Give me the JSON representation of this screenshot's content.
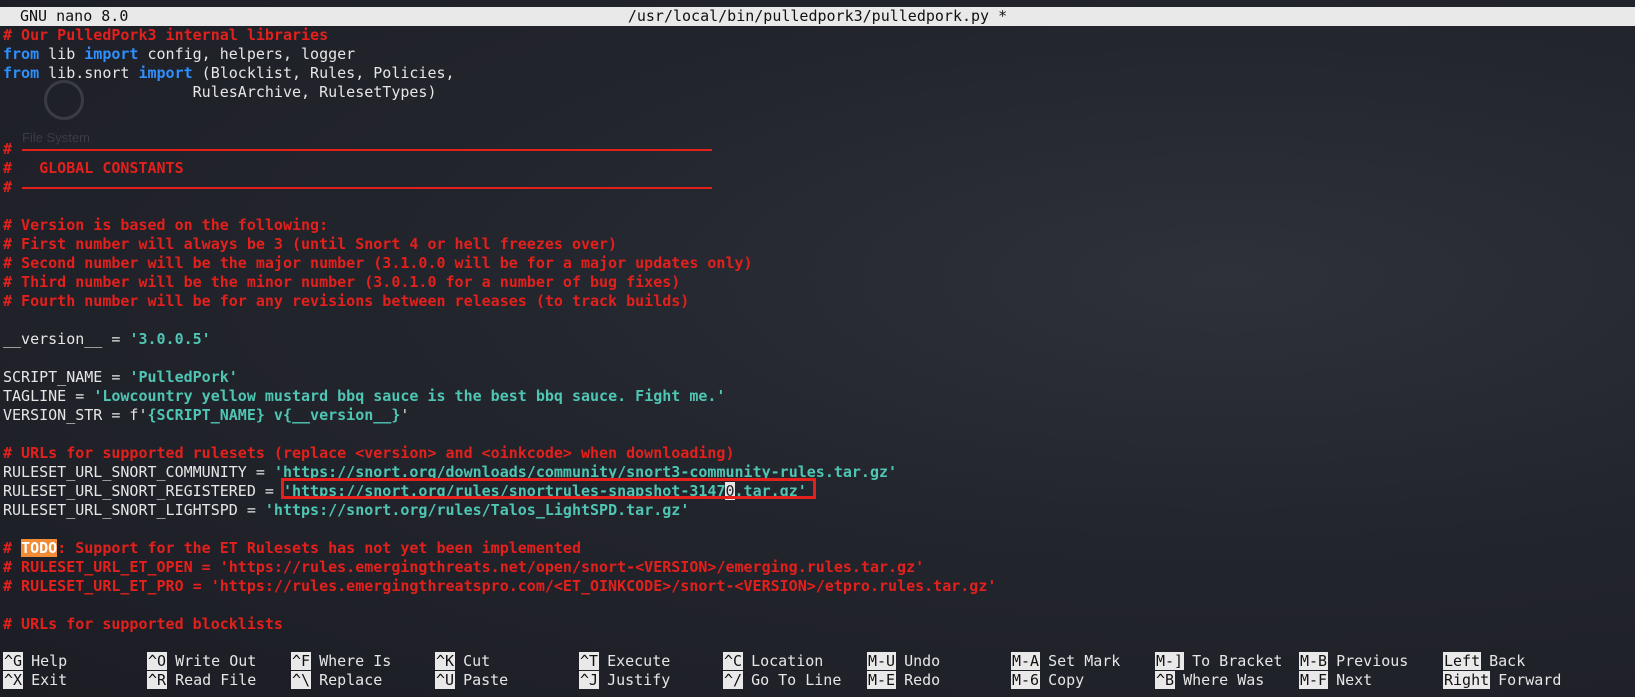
{
  "title": {
    "app": "GNU nano 8.0",
    "file": "/usr/local/bin/pulledpork3/pulledpork.py *"
  },
  "desktop": {
    "ghost_label": "File System"
  },
  "code": {
    "l1": "# Our PulledPork3 internal libraries",
    "l2_from": "from",
    "l2_mod": " lib ",
    "l2_import": "import",
    "l2_rest": " config, helpers, logger",
    "l3_from": "from",
    "l3_mod": " lib.snort ",
    "l3_import": "import",
    "l3_rest": " (Blocklist, Rules, Policies,",
    "l4": "                     RulesArchive, RulesetTypes)",
    "l7_hash": "#",
    "l8": "#   GLOBAL CONSTANTS",
    "l9_hash": "#",
    "l11": "# Version is based on the following:",
    "l12": "# First number will always be 3 (until Snort 4 or hell freezes over)",
    "l13": "# Second number will be the major number (3.1.0.0 will be for a major updates only)",
    "l14": "# Third number will be the minor number (3.0.1.0 for a number of bug fixes)",
    "l15": "# Fourth number will be for any revisions between releases (to track builds)",
    "l17_var": "__version__ = ",
    "l17_val": "'3.0.0.5'",
    "l19_var": "SCRIPT_NAME = ",
    "l19_val": "'PulledPork'",
    "l20_var": "TAGLINE = ",
    "l20_val": "'Lowcountry yellow mustard bbq sauce is the best bbq sauce. Fight me.'",
    "l21_var": "VERSION_STR = f'",
    "l21_val": "{SCRIPT_NAME} v{__version__}",
    "l21_end": "'",
    "l23": "# URLs for supported rulesets (replace <version> and <oinkcode> when downloading)",
    "l24_var": "RULESET_URL_SNORT_COMMUNITY = ",
    "l24_val": "'https://snort.org/downloads/community/snort3-community-rules.tar.gz'",
    "l25_var": "RULESET_URL_SNORT_REGISTERED = ",
    "l25_val_a": "'https://snort.org/rules/snortrules-snapshot-3147",
    "l25_cursor": "0",
    "l25_val_b": ".tar.gz'",
    "l26_var": "RULESET_URL_SNORT_LIGHTSPD = ",
    "l26_val": "'https://snort.org/rules/Talos_LightSPD.tar.gz'",
    "l28_hash": "# ",
    "l28_todo": "TODO",
    "l28_rest": ": Support for the ET Rulesets has not yet been implemented",
    "l29": "# RULESET_URL_ET_OPEN = 'https://rules.emergingthreats.net/open/snort-<VERSION>/emerging.rules.tar.gz'",
    "l30": "# RULESET_URL_ET_PRO = 'https://rules.emergingthreatspro.com/<ET_OINKCODE>/snort-<VERSION>/etpro.rules.tar.gz'",
    "l32": "# URLs for supported blocklists"
  },
  "shortcuts_row1": [
    {
      "key": "^G",
      "label": "Help"
    },
    {
      "key": "^O",
      "label": "Write Out"
    },
    {
      "key": "^F",
      "label": "Where Is"
    },
    {
      "key": "^K",
      "label": "Cut"
    },
    {
      "key": "^T",
      "label": "Execute"
    },
    {
      "key": "^C",
      "label": "Location"
    },
    {
      "key": "M-U",
      "label": "Undo"
    },
    {
      "key": "M-A",
      "label": "Set Mark"
    },
    {
      "key": "M-]",
      "label": "To Bracket"
    },
    {
      "key": "M-B",
      "label": "Previous"
    },
    {
      "key": "Left",
      "label": "Back"
    }
  ],
  "shortcuts_row2": [
    {
      "key": "^X",
      "label": "Exit"
    },
    {
      "key": "^R",
      "label": "Read File"
    },
    {
      "key": "^\\",
      "label": "Replace"
    },
    {
      "key": "^U",
      "label": "Paste"
    },
    {
      "key": "^J",
      "label": "Justify"
    },
    {
      "key": "^/",
      "label": "Go To Line"
    },
    {
      "key": "M-E",
      "label": "Redo"
    },
    {
      "key": "M-6",
      "label": "Copy"
    },
    {
      "key": "^B",
      "label": "Where Was"
    },
    {
      "key": "M-F",
      "label": "Next"
    },
    {
      "key": "Right",
      "label": "Forward"
    }
  ],
  "colors": {
    "comment": "#e3201b",
    "keyword": "#2f8ffd",
    "string": "#4fc5b4",
    "todo_highlight": "#f18b35",
    "background": "#20222b"
  }
}
